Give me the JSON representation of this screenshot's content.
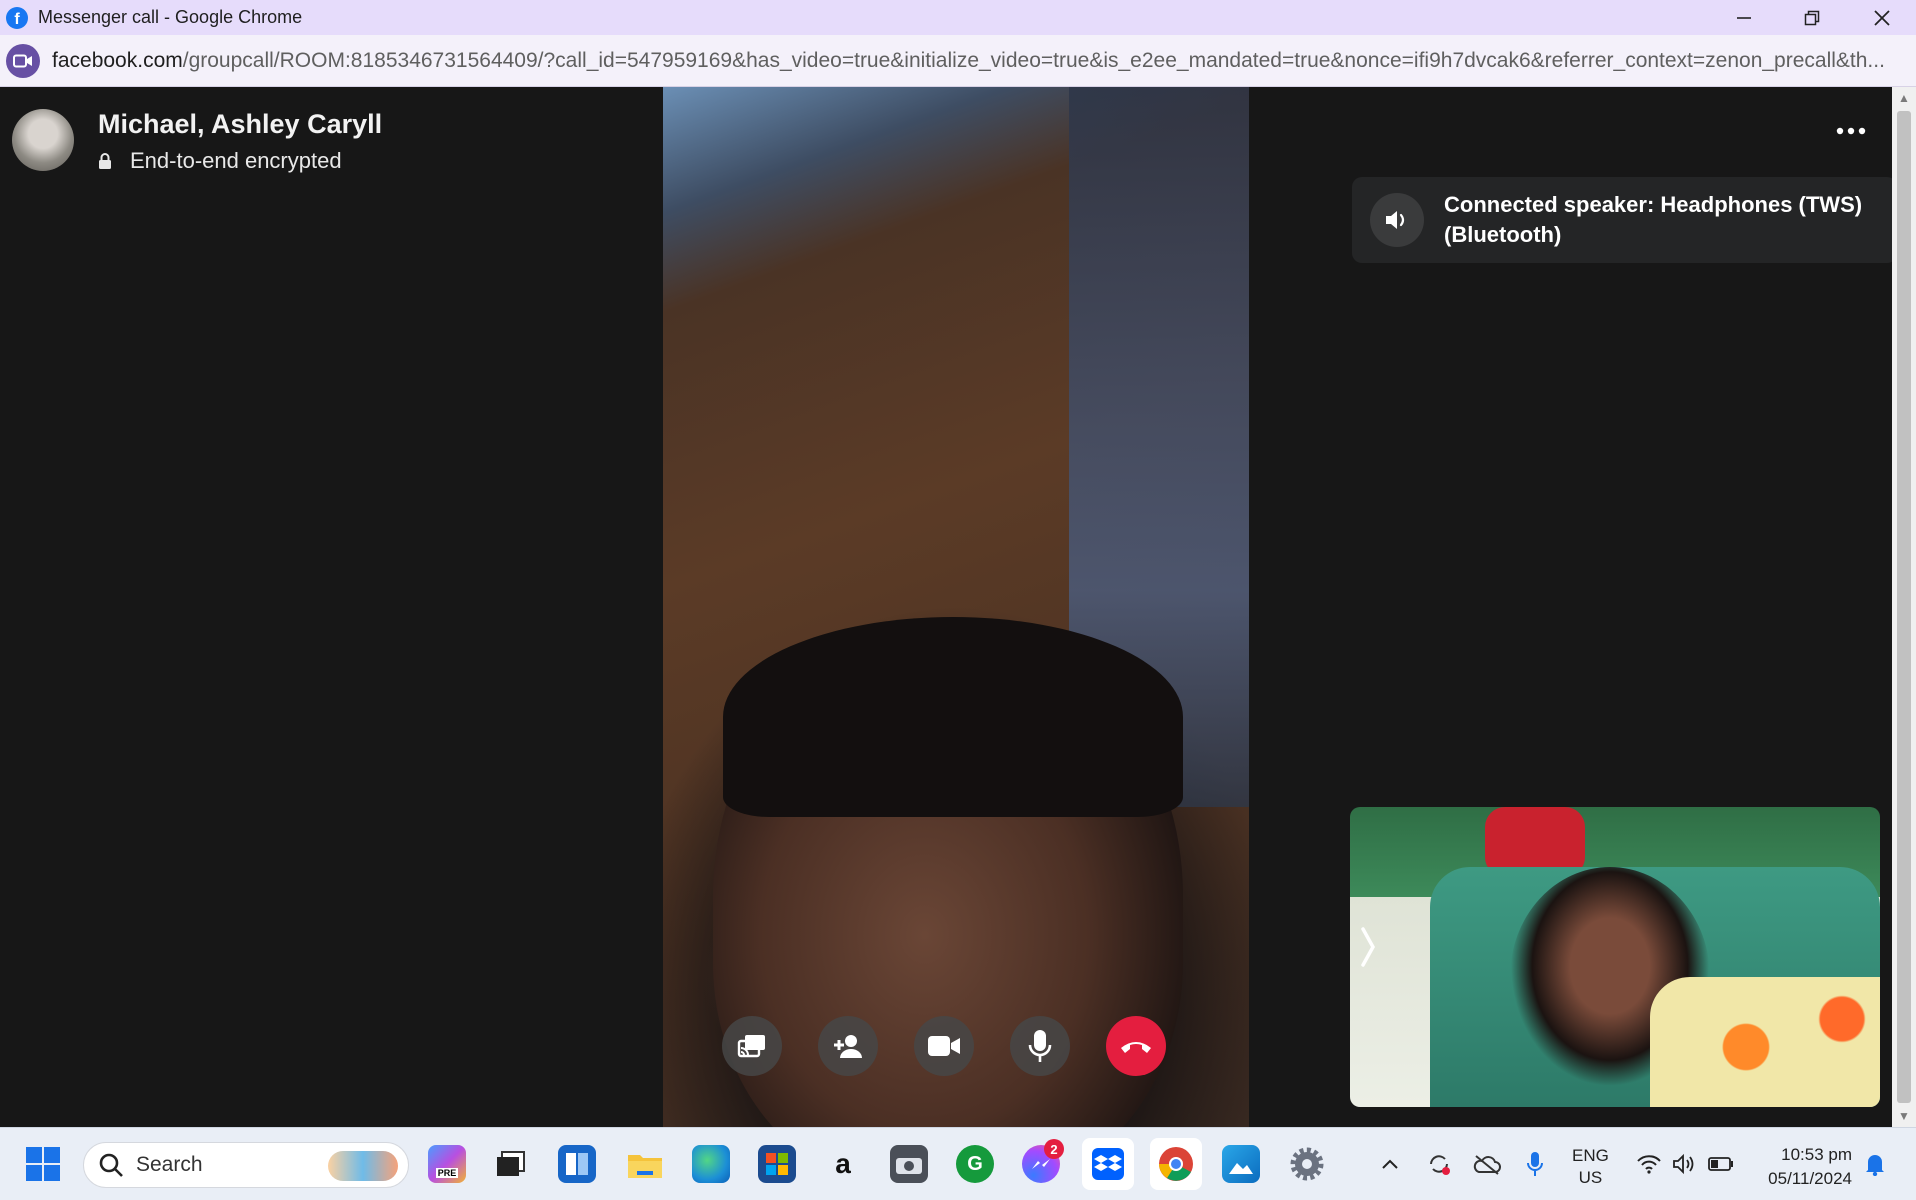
{
  "window": {
    "title": "Messenger call - Google Chrome",
    "favicon": "facebook-icon"
  },
  "addressbar": {
    "domain": "facebook.com",
    "path": "/groupcall/ROOM:8185346731564409/?call_id=547959169&has_video=true&initialize_video=true&is_e2ee_mandated=true&nonce=ifi9h7dvcak6&referrer_context=zenon_precall&th..."
  },
  "call": {
    "title": "Michael, Ashley Caryll",
    "encryption": "End-to-end encrypted",
    "toast": "Connected speaker: Headphones (TWS) (Bluetooth)",
    "end_color": "#e41e3f",
    "controls": [
      "share-screen-icon",
      "add-person-icon",
      "video-camera-icon",
      "microphone-icon",
      "end-call-icon"
    ]
  },
  "taskbar": {
    "search_placeholder": "Search",
    "messenger_badge": "2",
    "lang_line1": "ENG",
    "lang_line2": "US",
    "time": "10:53 pm",
    "date": "05/11/2024"
  }
}
